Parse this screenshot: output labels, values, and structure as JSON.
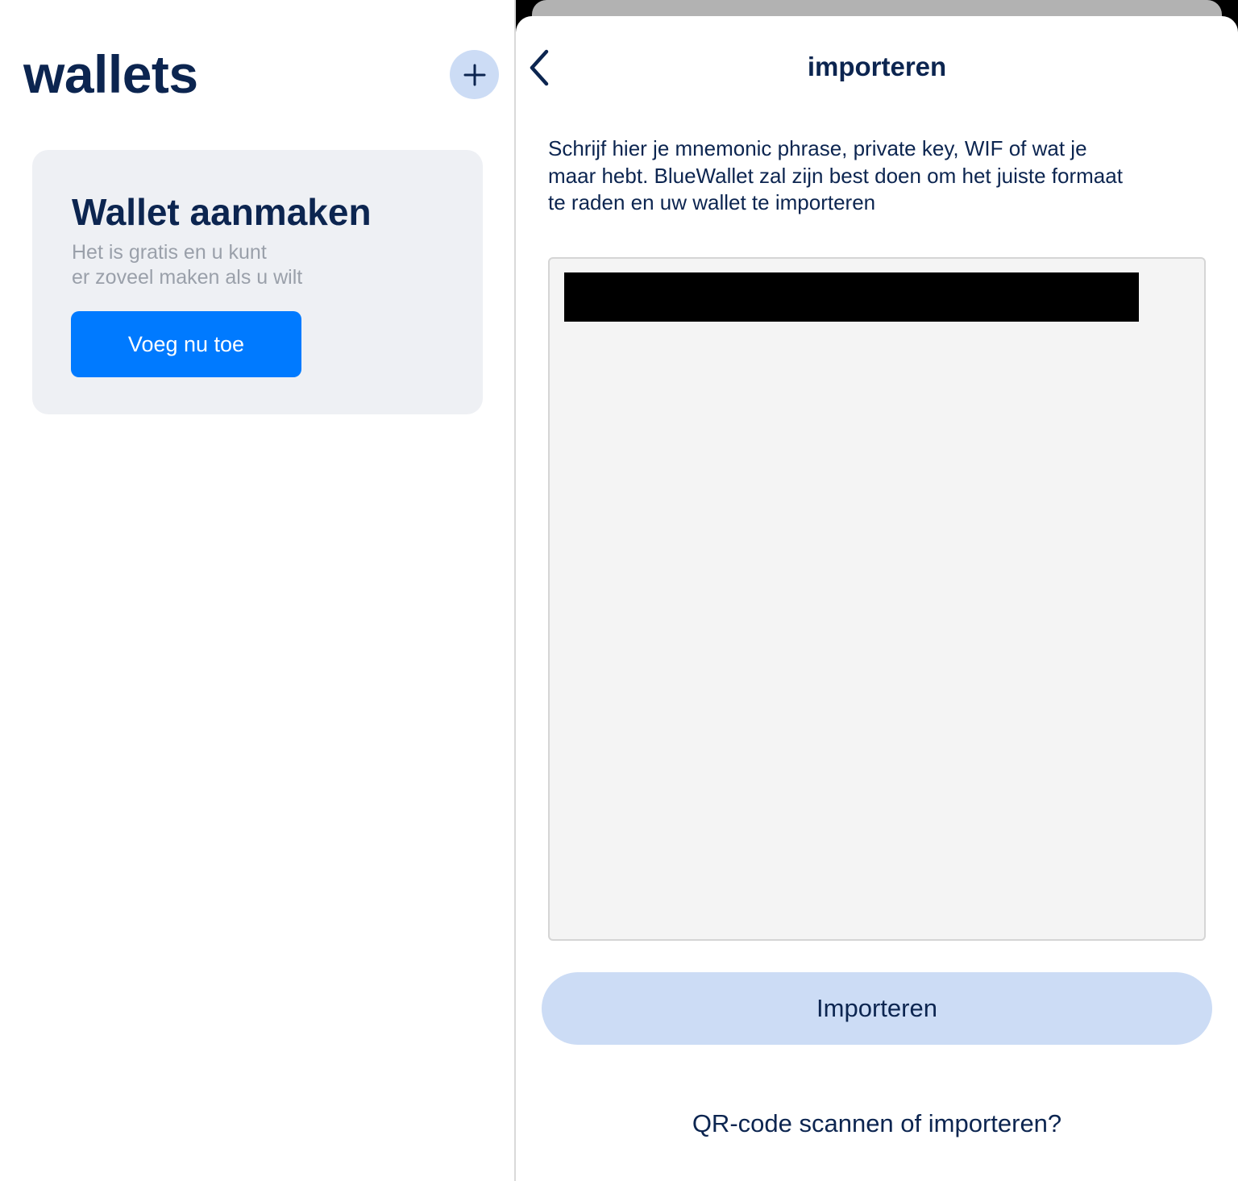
{
  "wallets_screen": {
    "title": "wallets",
    "add_icon": "plus-icon",
    "create_card": {
      "title": "Wallet aanmaken",
      "subtitle_line1": "Het is gratis en u kunt",
      "subtitle_line2": "er zoveel maken als u wilt",
      "button_label": "Voeg nu toe"
    }
  },
  "import_screen": {
    "nav_title": "importeren",
    "back_icon": "chevron-left-icon",
    "description_lines": [
      "Schrijf hier je mnemonic phrase, private key, WIF of wat je",
      "maar hebt. BlueWallet zal zijn best doen om het juiste formaat",
      "te raden en uw wallet te importeren"
    ],
    "input_value": "[redacted]",
    "import_button_label": "Importeren",
    "qr_link_label": "QR-code scannen of importeren?"
  },
  "colors": {
    "navy_text": "#0c2550",
    "accent_blue": "#007aff",
    "light_blue": "#ccdcf5",
    "card_bg": "#eef0f4",
    "input_bg": "#f4f4f4",
    "muted_text": "#9aa0aa"
  }
}
